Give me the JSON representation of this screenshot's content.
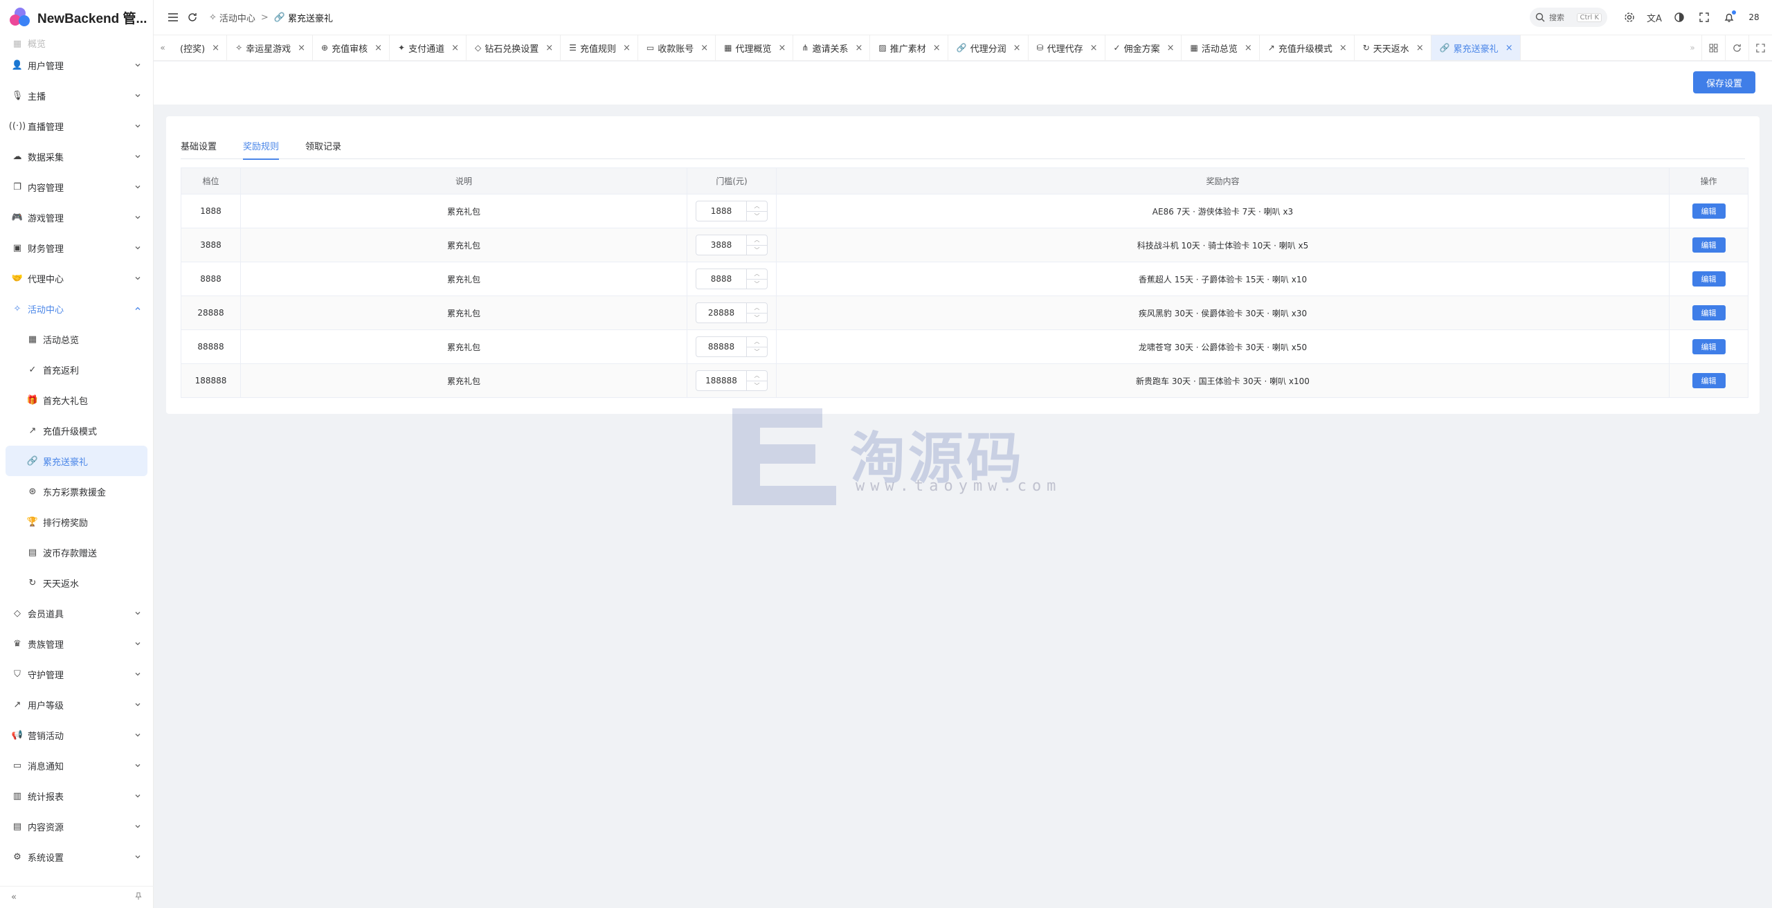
{
  "app": {
    "name": "NewBackend 管..."
  },
  "sidebar": {
    "partial_label": "概览",
    "items": [
      {
        "label": "用户管理",
        "icon": "user-icon"
      },
      {
        "label": "主播",
        "icon": "mic-icon"
      },
      {
        "label": "直播管理",
        "icon": "broadcast-icon"
      },
      {
        "label": "数据采集",
        "icon": "cloud-icon"
      },
      {
        "label": "内容管理",
        "icon": "layers-icon"
      },
      {
        "label": "游戏管理",
        "icon": "gamepad-icon"
      },
      {
        "label": "财务管理",
        "icon": "wallet-icon"
      },
      {
        "label": "代理中心",
        "icon": "handshake-icon"
      },
      {
        "label": "活动中心",
        "icon": "sparkle-icon"
      }
    ],
    "sub_items": [
      {
        "label": "活动总览",
        "icon": "grid-icon"
      },
      {
        "label": "首充返利",
        "icon": "check-circle-icon"
      },
      {
        "label": "首充大礼包",
        "icon": "gift-icon"
      },
      {
        "label": "充值升级模式",
        "icon": "trend-up-icon"
      },
      {
        "label": "累充送豪礼",
        "icon": "link-icon"
      },
      {
        "label": "东方彩票救援金",
        "icon": "lifebuoy-icon"
      },
      {
        "label": "排行榜奖励",
        "icon": "trophy-icon"
      },
      {
        "label": "波币存款赠送",
        "icon": "box-icon"
      },
      {
        "label": "天天返水",
        "icon": "refresh-icon"
      }
    ],
    "items_after": [
      {
        "label": "会员道具",
        "icon": "diamond-icon"
      },
      {
        "label": "贵族管理",
        "icon": "crown-icon"
      },
      {
        "label": "守护管理",
        "icon": "shield-icon"
      },
      {
        "label": "用户等级",
        "icon": "trend-up-icon"
      },
      {
        "label": "营销活动",
        "icon": "megaphone-icon"
      },
      {
        "label": "消息通知",
        "icon": "message-icon"
      },
      {
        "label": "统计报表",
        "icon": "bar-chart-icon"
      },
      {
        "label": "内容资源",
        "icon": "folder-icon"
      },
      {
        "label": "系统设置",
        "icon": "gear-icon"
      }
    ]
  },
  "header": {
    "breadcrumb": [
      "活动中心",
      "累充送豪礼"
    ],
    "search_placeholder": "搜索",
    "search_shortcut": "Ctrl K",
    "avatar_text": "28"
  },
  "tabs": [
    {
      "label": "(控奖)",
      "icon": ""
    },
    {
      "label": "幸运星游戏",
      "icon": "sparkle-icon"
    },
    {
      "label": "充值审核",
      "icon": "plus-circle-icon"
    },
    {
      "label": "支付通道",
      "icon": "wand-icon"
    },
    {
      "label": "钻石兑换设置",
      "icon": "diamond-icon"
    },
    {
      "label": "充值规则",
      "icon": "list-icon"
    },
    {
      "label": "收款账号",
      "icon": "card-icon"
    },
    {
      "label": "代理概览",
      "icon": "grid-icon"
    },
    {
      "label": "邀请关系",
      "icon": "share-icon"
    },
    {
      "label": "推广素材",
      "icon": "image-icon"
    },
    {
      "label": "代理分润",
      "icon": "link-icon"
    },
    {
      "label": "代理代存",
      "icon": "database-icon"
    },
    {
      "label": "佣金方案",
      "icon": "check-circle-icon"
    },
    {
      "label": "活动总览",
      "icon": "grid-icon"
    },
    {
      "label": "充值升级模式",
      "icon": "trend-up-icon"
    },
    {
      "label": "天天返水",
      "icon": "refresh-icon"
    },
    {
      "label": "累充送豪礼",
      "icon": "link-icon",
      "active": true
    }
  ],
  "toolbar": {
    "save_label": "保存设置"
  },
  "subtabs": [
    {
      "label": "基础设置"
    },
    {
      "label": "奖励规则",
      "active": true
    },
    {
      "label": "领取记录"
    }
  ],
  "table": {
    "columns": [
      "档位",
      "说明",
      "门槛(元)",
      "奖励内容",
      "操作"
    ],
    "edit_label": "编辑",
    "rows": [
      {
        "tier": "1888",
        "desc": "累充礼包",
        "threshold": "1888",
        "reward": "AE86 7天 · 游侠体验卡 7天 · 喇叭 x3"
      },
      {
        "tier": "3888",
        "desc": "累充礼包",
        "threshold": "3888",
        "reward": "科技战斗机 10天 · 骑士体验卡 10天 · 喇叭 x5"
      },
      {
        "tier": "8888",
        "desc": "累充礼包",
        "threshold": "8888",
        "reward": "香蕉超人 15天 · 子爵体验卡 15天 · 喇叭 x10"
      },
      {
        "tier": "28888",
        "desc": "累充礼包",
        "threshold": "28888",
        "reward": "疾风黑豹 30天 · 侯爵体验卡 30天 · 喇叭 x30"
      },
      {
        "tier": "88888",
        "desc": "累充礼包",
        "threshold": "88888",
        "reward": "龙啸苍穹 30天 · 公爵体验卡 30天 · 喇叭 x50"
      },
      {
        "tier": "188888",
        "desc": "累充礼包",
        "threshold": "188888",
        "reward": "新贵跑车 30天 · 国王体验卡 30天 · 喇叭 x100"
      }
    ]
  },
  "watermark": {
    "title": "淘源码",
    "url": "www.taoymw.com"
  },
  "colors": {
    "accent": "#3f7ee8",
    "active_bg": "#e7effd",
    "page_bg": "#f0f2f5"
  }
}
